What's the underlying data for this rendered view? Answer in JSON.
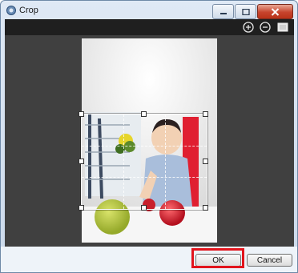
{
  "window": {
    "title": "Crop"
  },
  "toolbar": {
    "icons": [
      "zoom-in-icon",
      "zoom-out-icon",
      "fit-to-window-icon"
    ]
  },
  "footer": {
    "ok_label": "OK",
    "cancel_label": "Cancel"
  },
  "colors": {
    "highlight": "#e2141c",
    "toolbar_bg": "#1f1f1f",
    "canvas_bg": "#404040"
  }
}
